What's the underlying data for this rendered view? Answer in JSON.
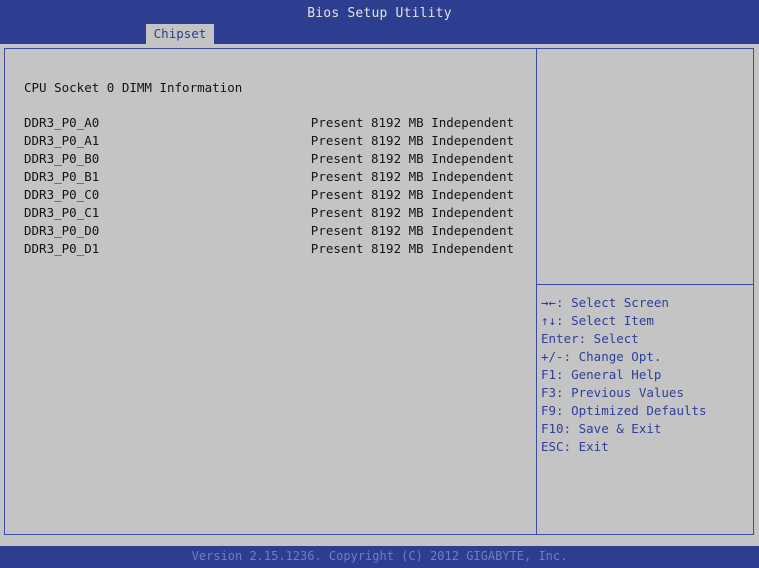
{
  "header": {
    "title": "Bios Setup Utility",
    "tab_label": "Chipset"
  },
  "main": {
    "section_title": "CPU Socket 0 DIMM Information",
    "dimms": [
      {
        "name": "DDR3_P0_A0",
        "value": "Present 8192 MB Independent"
      },
      {
        "name": "DDR3_P0_A1",
        "value": "Present 8192 MB Independent"
      },
      {
        "name": "DDR3_P0_B0",
        "value": "Present 8192 MB Independent"
      },
      {
        "name": "DDR3_P0_B1",
        "value": "Present 8192 MB Independent"
      },
      {
        "name": "DDR3_P0_C0",
        "value": "Present 8192 MB Independent"
      },
      {
        "name": "DDR3_P0_C1",
        "value": "Present 8192 MB Independent"
      },
      {
        "name": "DDR3_P0_D0",
        "value": "Present 8192 MB Independent"
      },
      {
        "name": "DDR3_P0_D1",
        "value": "Present 8192 MB Independent"
      }
    ]
  },
  "help": {
    "items": [
      "→←: Select Screen",
      "↑↓: Select Item",
      "Enter: Select",
      "+/-: Change Opt.",
      "F1: General Help",
      "F3: Previous Values",
      "F9: Optimized Defaults",
      "F10: Save & Exit",
      "ESC: Exit"
    ]
  },
  "footer": {
    "text": "Version 2.15.1236. Copyright (C) 2012 GIGABYTE, Inc."
  },
  "colors": {
    "bar_blue": "#2d3d8f",
    "panel_gray": "#c4c4c4",
    "help_text_blue": "#2f3f9a"
  }
}
